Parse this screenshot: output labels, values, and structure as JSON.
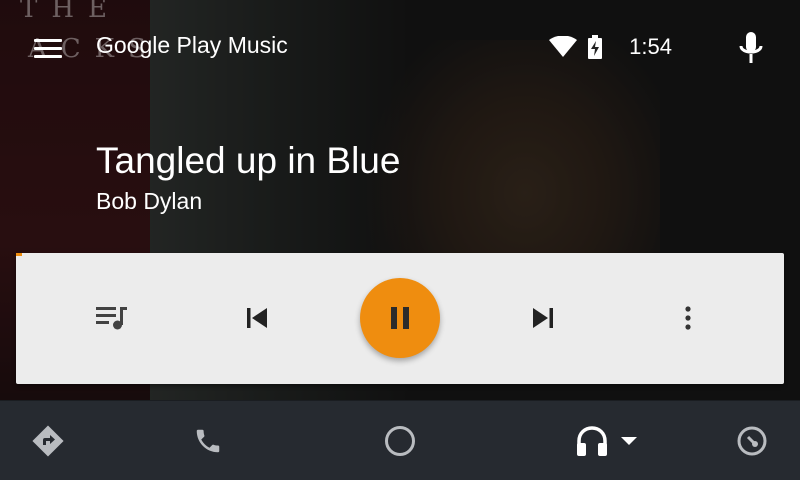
{
  "app": {
    "title": "Google Play Music"
  },
  "album_art": {
    "text_top": "THE",
    "text_mid": "ACKS"
  },
  "status": {
    "time": "1:54"
  },
  "track": {
    "title": "Tangled up in Blue",
    "artist": "Bob Dylan"
  },
  "playback": {
    "state": "playing",
    "progress_fraction": 0.008
  },
  "controls": {
    "queue_icon": "queue-music-icon",
    "prev_icon": "skip-previous-icon",
    "play_icon": "pause-icon",
    "next_icon": "skip-next-icon",
    "more_icon": "more-vert-icon"
  },
  "bottom_nav": [
    {
      "icon": "navigation-icon"
    },
    {
      "icon": "phone-icon"
    },
    {
      "icon": "home-circle-icon"
    },
    {
      "icon": "headphones-icon",
      "active": true
    },
    {
      "icon": "car-gauge-icon"
    }
  ],
  "colors": {
    "accent": "#ef8d0f",
    "card": "#ececec",
    "nav_bg": "#262a30",
    "icon_dark": "#424242",
    "nav_icon": "#b9bcc0"
  }
}
